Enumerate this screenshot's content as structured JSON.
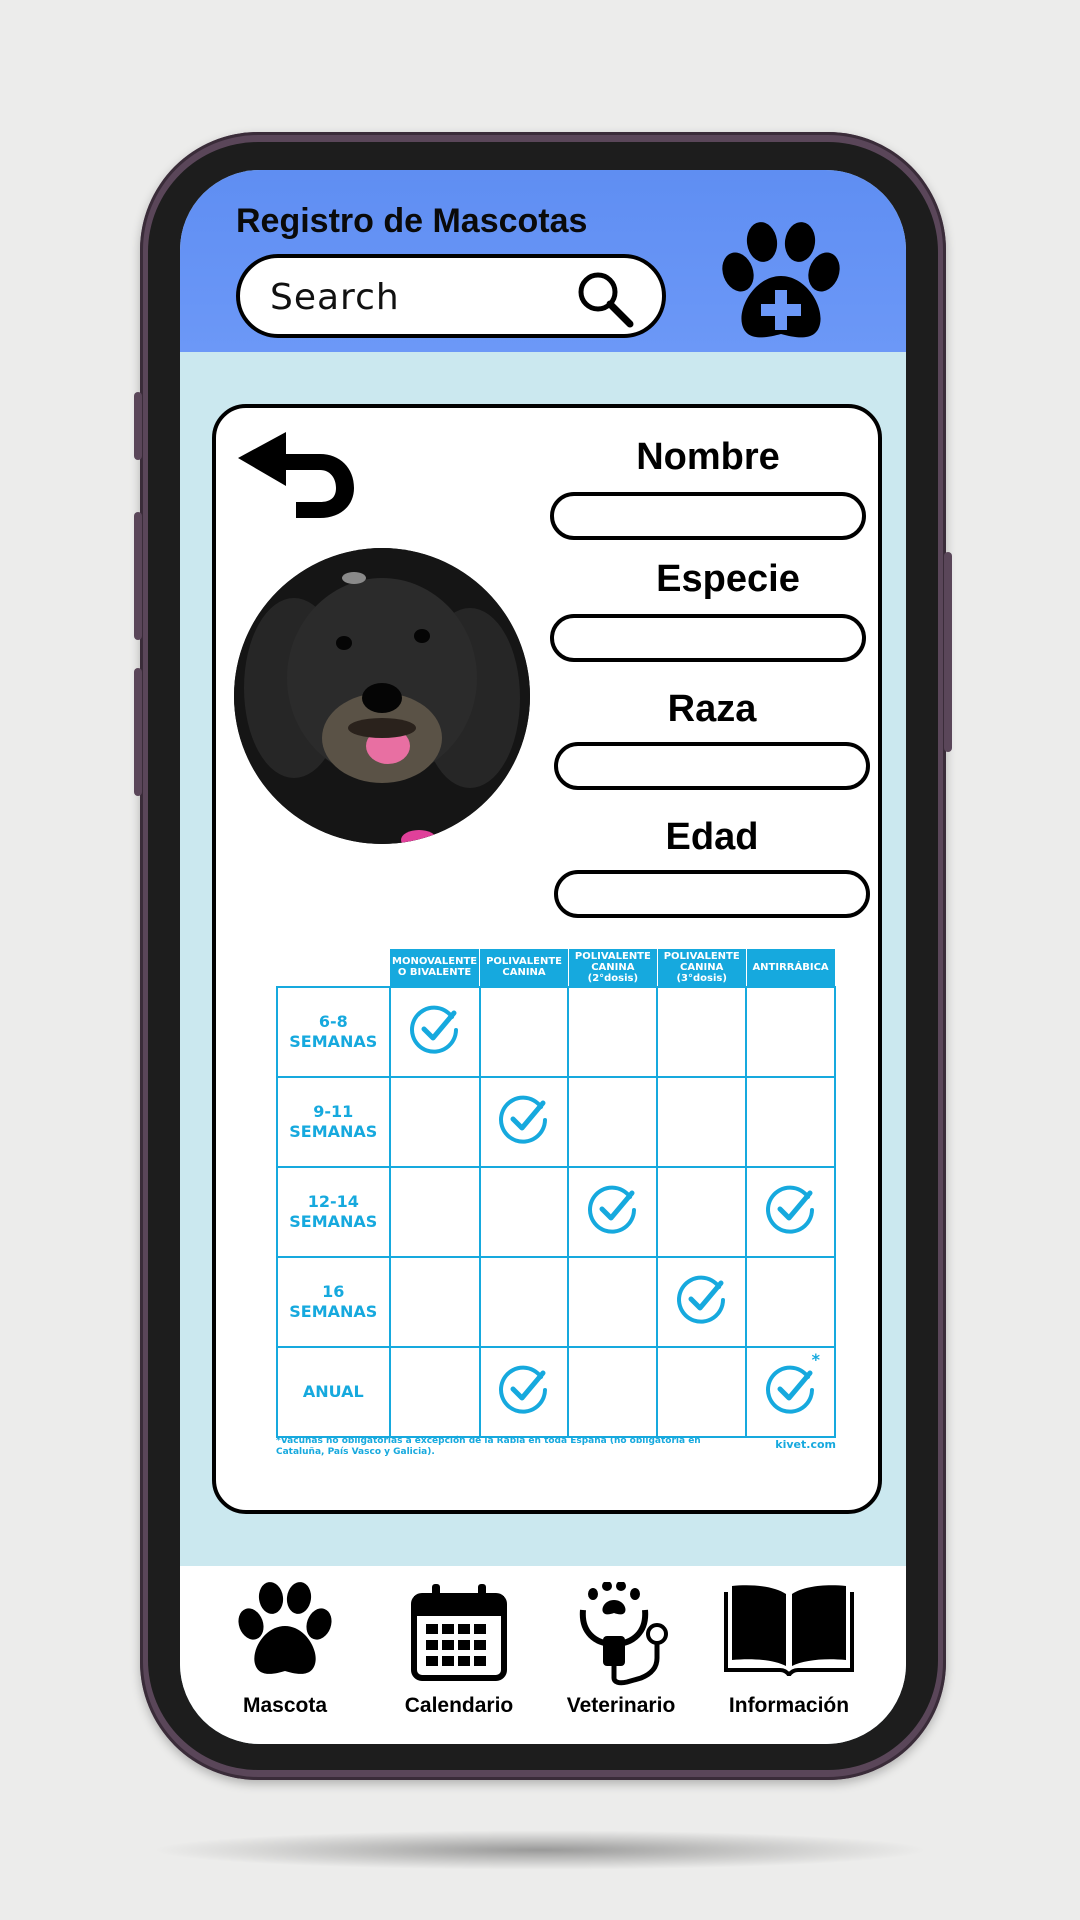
{
  "app": {
    "title": "Registro de Mascotas"
  },
  "search": {
    "placeholder": "Search"
  },
  "form": {
    "fields": [
      {
        "label": "Nombre",
        "value": ""
      },
      {
        "label": "Especie",
        "value": ""
      },
      {
        "label": "Raza",
        "value": ""
      },
      {
        "label": "Edad",
        "value": ""
      }
    ]
  },
  "vaccine_table": {
    "columns": [
      [
        "MONOVALENTE",
        "O BIVALENTE"
      ],
      [
        "POLIVALENTE",
        "CANINA"
      ],
      [
        "POLIVALENTE",
        "CANINA",
        "(2°dosis)"
      ],
      [
        "POLIVALENTE",
        "CANINA",
        "(3°dosis)"
      ],
      [
        "ANTIRRÁBICA"
      ]
    ],
    "rows": [
      {
        "label": [
          "6-8",
          "SEMANAS"
        ],
        "checks": [
          true,
          false,
          false,
          false,
          false
        ]
      },
      {
        "label": [
          "9-11",
          "SEMANAS"
        ],
        "checks": [
          false,
          true,
          false,
          false,
          false
        ]
      },
      {
        "label": [
          "12-14",
          "SEMANAS"
        ],
        "checks": [
          false,
          false,
          true,
          false,
          true
        ]
      },
      {
        "label": [
          "16",
          "SEMANAS"
        ],
        "checks": [
          false,
          false,
          false,
          true,
          false
        ]
      },
      {
        "label": [
          "ANUAL"
        ],
        "checks": [
          false,
          true,
          false,
          false,
          true
        ],
        "asterisk_col": 4
      }
    ],
    "footnote": "*Vacunas no obligatorias a excepción de la Rabia en toda España (no obligatoria en Cataluña, País Vasco y Galicia).",
    "source": "kivet.com",
    "accent_color": "#16a9de"
  },
  "nav": {
    "items": [
      {
        "label": "Mascota",
        "icon": "paw-icon"
      },
      {
        "label": "Calendario",
        "icon": "calendar-icon"
      },
      {
        "label": "Veterinario",
        "icon": "stethoscope-icon"
      },
      {
        "label": "Información",
        "icon": "book-icon"
      }
    ]
  },
  "colors": {
    "header": "#6c98f7",
    "background": "#cbe8ef"
  }
}
